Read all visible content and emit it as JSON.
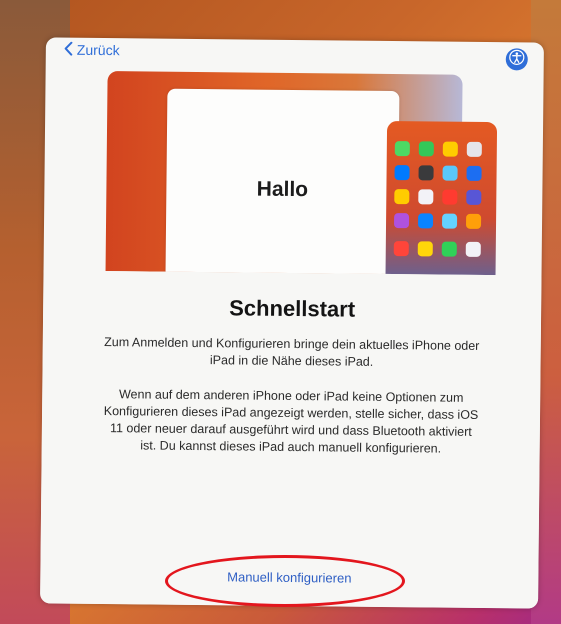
{
  "nav": {
    "back_label": "Zurück"
  },
  "illustration": {
    "hello_text": "Hallo"
  },
  "main": {
    "title": "Schnellstart",
    "paragraph_1": "Zum Anmelden und Konfigurieren bringe dein aktuelles iPhone oder iPad in die Nähe dieses iPad.",
    "paragraph_2": "Wenn auf dem anderen iPhone oder iPad keine Optionen zum Konfigurieren dieses iPad angezeigt werden, stelle sicher, dass iOS 11 oder neuer darauf ausgeführt wird und dass Bluetooth aktiviert ist. Du kannst dieses iPad auch manuell konfigurieren.",
    "manual_button_label": "Manuell konfigurieren"
  },
  "colors": {
    "accent": "#2f6ed8",
    "highlight_ring": "#e3161d"
  },
  "icons": {
    "back": "chevron-left-icon",
    "accessibility": "accessibility-icon"
  }
}
